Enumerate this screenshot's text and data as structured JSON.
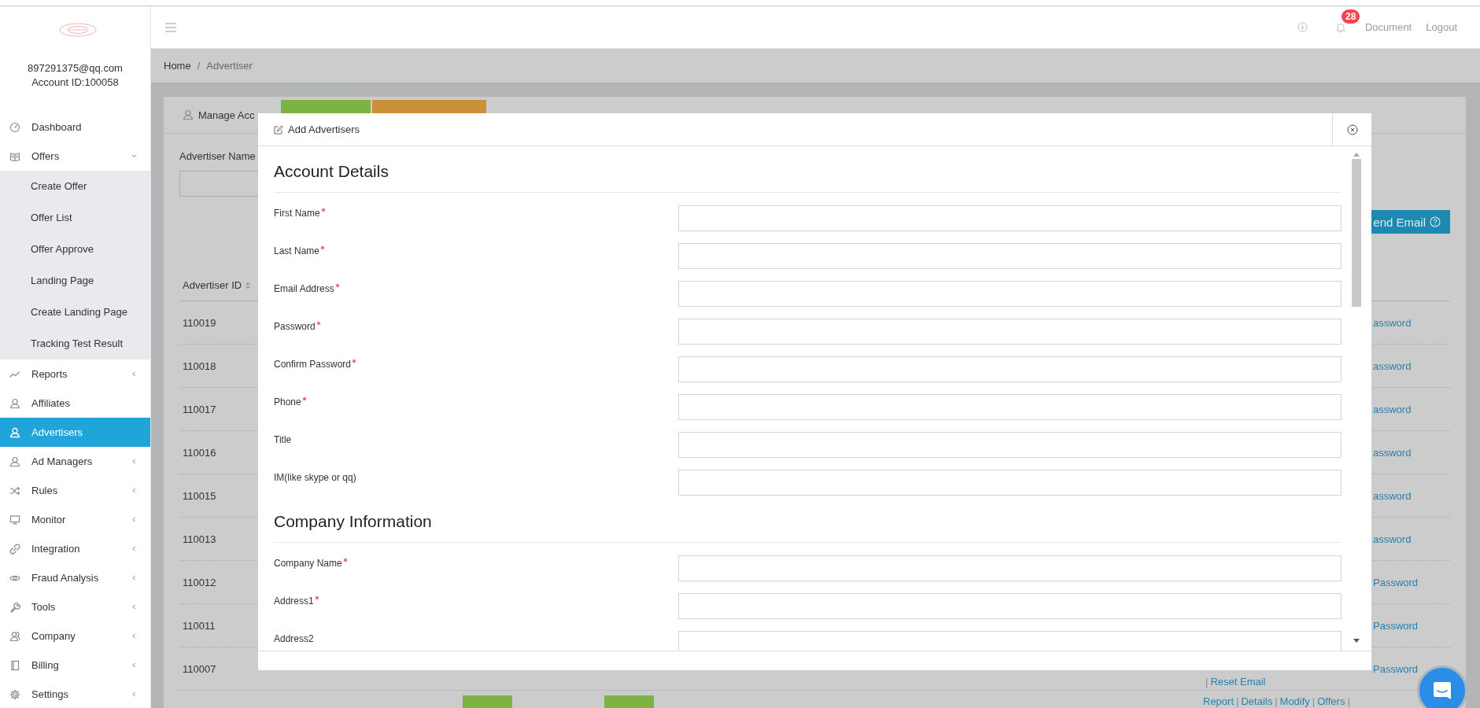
{
  "sidebar": {
    "account_email": "897291375@qq.com",
    "account_id": "Account ID:100058",
    "items": [
      {
        "label": "Dashboard",
        "kind": "link",
        "selected": false
      },
      {
        "label": "Offers",
        "kind": "menu",
        "expanded": true,
        "selected": false,
        "children": [
          {
            "label": "Create Offer",
            "selected": false
          },
          {
            "label": "Offer List",
            "selected": false
          },
          {
            "label": "Offer Approve",
            "selected": false
          },
          {
            "label": "Landing Page",
            "selected": false
          },
          {
            "label": "Create Landing Page",
            "selected": false
          },
          {
            "label": "Tracking Test Result",
            "selected": false
          }
        ]
      },
      {
        "label": "Reports",
        "kind": "menu",
        "expanded": false,
        "selected": false
      },
      {
        "label": "Affiliates",
        "kind": "link",
        "selected": false
      },
      {
        "label": "Advertisers",
        "kind": "link",
        "selected": true
      },
      {
        "label": "Ad Managers",
        "kind": "menu",
        "expanded": false,
        "selected": false
      },
      {
        "label": "Rules",
        "kind": "menu",
        "expanded": false,
        "selected": false
      },
      {
        "label": "Monitor",
        "kind": "menu",
        "expanded": false,
        "selected": false
      },
      {
        "label": "Integration",
        "kind": "menu",
        "expanded": false,
        "selected": false
      },
      {
        "label": "Fraud Analysis",
        "kind": "menu",
        "expanded": false,
        "selected": false
      },
      {
        "label": "Tools",
        "kind": "menu",
        "expanded": false,
        "selected": false
      },
      {
        "label": "Company",
        "kind": "menu",
        "expanded": false,
        "selected": false
      },
      {
        "label": "Billing",
        "kind": "menu",
        "expanded": false,
        "selected": false
      },
      {
        "label": "Settings",
        "kind": "menu",
        "expanded": false,
        "selected": false
      }
    ]
  },
  "topbar": {
    "notification_count": "28",
    "links": [
      "Document",
      "Logout"
    ]
  },
  "breadcrumb": {
    "items": [
      "Home",
      "Advertiser"
    ],
    "separator": "/"
  },
  "panel": {
    "title": "Manage Acc",
    "filter_label": "Advertiser Name",
    "send_button": "end Email",
    "table": {
      "columns": [
        "Advertiser ID"
      ],
      "rows": [
        {
          "id": "110019",
          "action": "assword"
        },
        {
          "id": "110018",
          "action": "assword"
        },
        {
          "id": "110017",
          "action": "assword"
        },
        {
          "id": "110016",
          "action": "assword"
        },
        {
          "id": "110015",
          "action": "assword"
        },
        {
          "id": "110013",
          "action": "assword"
        },
        {
          "id": "110012",
          "action": "Password"
        },
        {
          "id": "110011",
          "action": "Password"
        },
        {
          "id": "110007",
          "action": "Password",
          "links": [
            {
              "kind": "separator",
              "text": "|"
            },
            {
              "kind": "link",
              "text": "Reset Email"
            }
          ]
        },
        {
          "badges": [
            {
              "color": "#7cb342"
            },
            {
              "color": "#7cb342"
            }
          ],
          "links": [
            {
              "kind": "link",
              "text": "Report"
            },
            {
              "kind": "separator",
              "text": "|"
            },
            {
              "kind": "link",
              "text": "Details"
            },
            {
              "kind": "separator",
              "text": "|"
            },
            {
              "kind": "link",
              "text": "Modify"
            },
            {
              "kind": "separator",
              "text": "|"
            },
            {
              "kind": "link",
              "text": "Offers"
            },
            {
              "kind": "separator",
              "text": "|"
            }
          ]
        }
      ]
    }
  },
  "modal": {
    "title": "Add Advertisers",
    "sections": [
      {
        "heading": "Account Details",
        "fields": [
          {
            "label": "First Name",
            "required": true
          },
          {
            "label": "Last Name",
            "required": true
          },
          {
            "label": "Email Address",
            "required": true
          },
          {
            "label": "Password",
            "required": true
          },
          {
            "label": "Confirm Password",
            "required": true
          },
          {
            "label": "Phone",
            "required": true
          },
          {
            "label": "Title",
            "required": false
          },
          {
            "label": "IM(like skype or qq)",
            "required": false
          }
        ]
      },
      {
        "heading": "Company Information",
        "fields": [
          {
            "label": "Company Name",
            "required": true
          },
          {
            "label": "Address1",
            "required": true
          },
          {
            "label": "Address2",
            "required": false
          }
        ]
      }
    ]
  }
}
